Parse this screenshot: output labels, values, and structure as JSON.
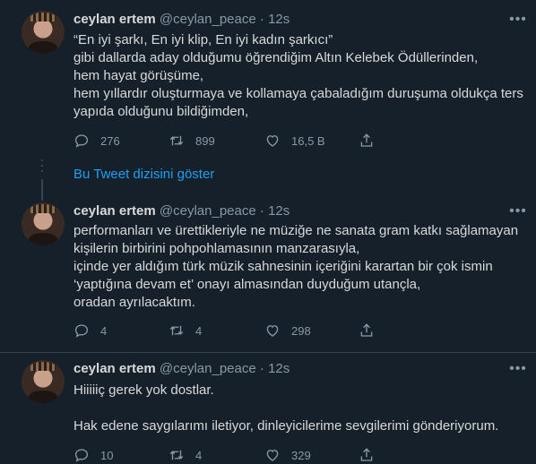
{
  "tweets": [
    {
      "name": "ceylan ertem",
      "handle": "@ceylan_peace",
      "sep": "·",
      "time": "12s",
      "lines": [
        "“En iyi şarkı, En iyi klip, En iyi kadın şarkıcı”",
        "gibi dallarda aday olduğumu öğrendiğim Altın Kelebek Ödüllerinden,",
        "hem hayat görüşüme,",
        "hem yıllardır oluşturmaya ve kollamaya çabaladığım duruşuma oldukça ters",
        "yapıda olduğunu bildiğimden,"
      ],
      "replies": "276",
      "retweets": "899",
      "likes": "16,5 B"
    },
    {
      "name": "ceylan ertem",
      "handle": "@ceylan_peace",
      "sep": "·",
      "time": "12s",
      "lines": [
        "performanları ve ürettikleriyle ne müziğe ne sanata gram katkı sağlamayan",
        "kişilerin birbirini pohpohlamasının manzarasıyla,",
        "içinde yer aldığım türk müzik sahnesinin içeriğini karartan bir çok ismin",
        "‘yaptığına devam et’ onayı almasından duyduğum utançla,",
        "oradan ayrılacaktım."
      ],
      "replies": "4",
      "retweets": "4",
      "likes": "298"
    },
    {
      "name": "ceylan ertem",
      "handle": "@ceylan_peace",
      "sep": "·",
      "time": "12s",
      "lines": [
        "Hiiiiiç gerek yok dostlar.",
        "",
        "Hak edene saygılarımı iletiyor, dinleyicilerime sevgilerimi gönderiyorum."
      ],
      "replies": "10",
      "retweets": "4",
      "likes": "329"
    }
  ],
  "show_thread_label": "Bu Tweet dizisini göster",
  "icons": {
    "more": "more-icon",
    "reply": "reply-icon",
    "retweet": "retweet-icon",
    "like": "heart-icon",
    "share": "share-icon"
  },
  "colors": {
    "background": "#15202b",
    "text": "#d9d9d9",
    "secondary": "#8899a6",
    "link": "#1da1f2",
    "border": "#38444d"
  }
}
